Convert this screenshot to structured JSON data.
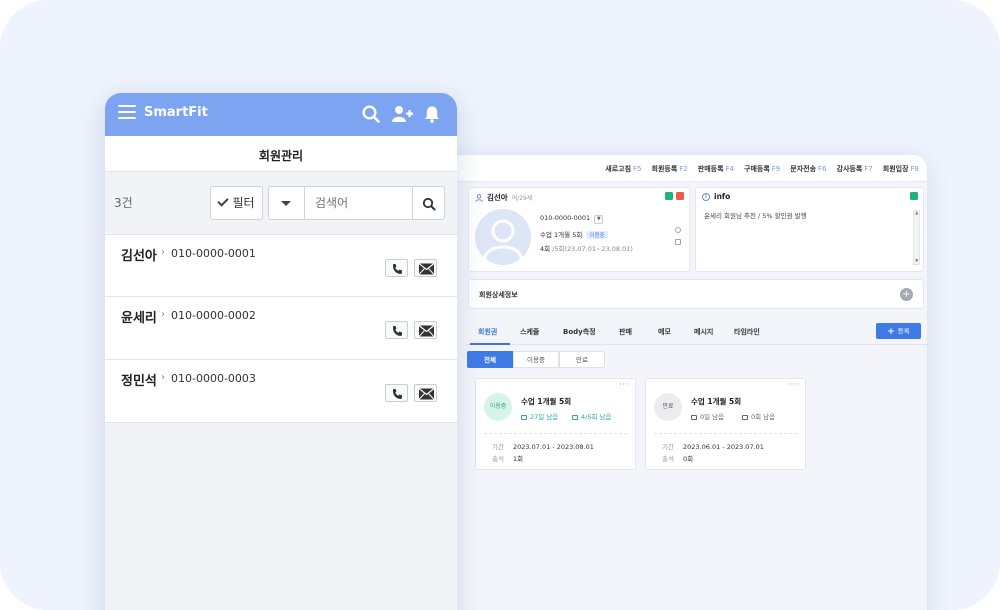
{
  "colors": {
    "accent": "#3f7be6",
    "header": "#7da4f0",
    "success": "#2aa880",
    "danger": "#ef5a4c"
  },
  "desktop": {
    "menu": [
      {
        "label": "새로고침",
        "key": "F5"
      },
      {
        "label": "회원등록",
        "key": "F2"
      },
      {
        "label": "판매등록",
        "key": "F4"
      },
      {
        "label": "구매등록",
        "key": "F9"
      },
      {
        "label": "문자전송",
        "key": "F6"
      },
      {
        "label": "강사등록",
        "key": "F7"
      },
      {
        "label": "회원입장",
        "key": "F8"
      }
    ],
    "member": {
      "name": "김선아",
      "sub": "여/29세",
      "phone": "010-0000-0001",
      "class_name": "수업 1개월 5회",
      "status": "이용중",
      "count_used": "4회",
      "count_detail": "/5회(23.07.01~23.08.01)"
    },
    "info": {
      "title": "info",
      "text": "윤세리 회원님 추천 / 5% 할인권 발행"
    },
    "detail_title": "회원상세정보",
    "tabs": [
      "회원권",
      "스케줄",
      "Body측정",
      "판매",
      "메모",
      "메시지",
      "타임라인"
    ],
    "add_button": "등록",
    "filters": [
      "전체",
      "이용중",
      "만료"
    ],
    "passes": [
      {
        "status": "이용중",
        "title": "수업 1개월 5회",
        "days_left": "27일 남음",
        "sessions_left": "4/5회 남음",
        "period_label": "기간",
        "period": "2023.07.01 - 2023.08.01",
        "attend_label": "출석",
        "attend": "1회"
      },
      {
        "status": "만료",
        "title": "수업 1개월 5회",
        "days_left": "0일 남음",
        "sessions_left": "0회 남음",
        "period_label": "기간",
        "period": "2023.06.01 - 2023.07.01",
        "attend_label": "출석",
        "attend": "0회"
      }
    ]
  },
  "mobile": {
    "brand": "SmartFit",
    "title": "회원관리",
    "count": "3건",
    "filter_label": "필터",
    "search_placeholder": "검색어",
    "members": [
      {
        "name": "김선아",
        "phone": "010-0000-0001"
      },
      {
        "name": "윤세리",
        "phone": "010-0000-0002"
      },
      {
        "name": "정민석",
        "phone": "010-0000-0003"
      }
    ]
  }
}
